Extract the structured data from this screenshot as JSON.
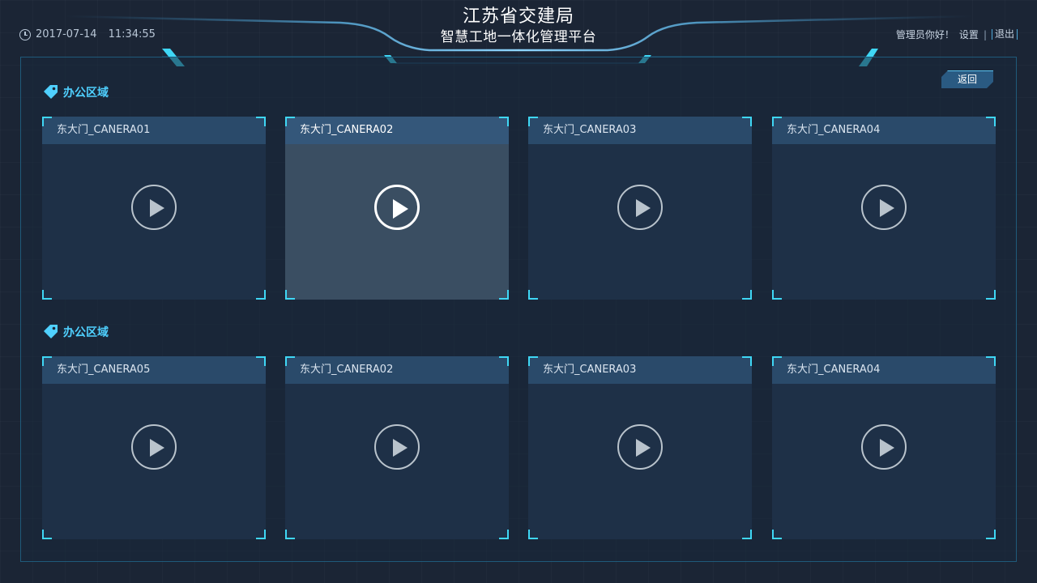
{
  "header": {
    "date": "2017-07-14",
    "time": "11:34:55",
    "title_main": "江苏省交建局",
    "title_sub": "智慧工地一体化管理平台",
    "greeting": "管理员你好！",
    "settings": "设置",
    "separator": "|",
    "logout": "退出"
  },
  "back_button": "返回",
  "accent_color": "#3fd7f5",
  "sections": [
    {
      "title": "办公区域",
      "cameras": [
        {
          "name": "东大门_CANERA01",
          "active": false
        },
        {
          "name": "东大门_CANERA02",
          "active": true
        },
        {
          "name": "东大门_CANERA03",
          "active": false
        },
        {
          "name": "东大门_CANERA04",
          "active": false
        }
      ]
    },
    {
      "title": "办公区域",
      "cameras": [
        {
          "name": "东大门_CANERA05",
          "active": false
        },
        {
          "name": "东大门_CANERA02",
          "active": false
        },
        {
          "name": "东大门_CANERA03",
          "active": false
        },
        {
          "name": "东大门_CANERA04",
          "active": false
        }
      ]
    }
  ]
}
